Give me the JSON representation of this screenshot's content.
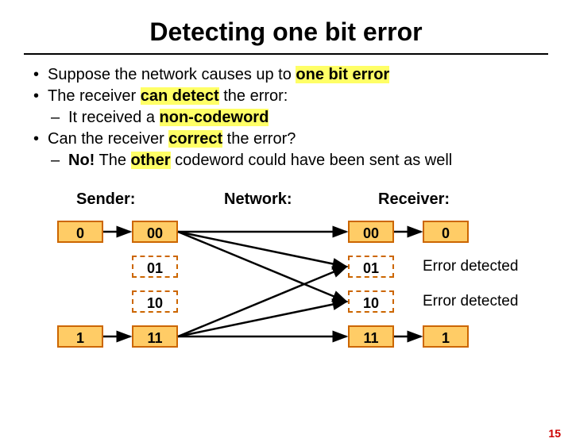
{
  "title": "Detecting one bit error",
  "bul": {
    "l1a": "Suppose the network causes up to ",
    "l1hl": "one bit error",
    "l2a": "The receiver ",
    "l2hl": "can detect",
    "l2b": " the error:",
    "l3a": "It received a ",
    "l3hl": "non-codeword",
    "l4a": "Can the receiver ",
    "l4hl": "correct",
    "l4b": " the error?",
    "l5a": "No!",
    "l5b": "  The ",
    "l5hl": "other",
    "l5c": " codeword could have been sent as well"
  },
  "cols": {
    "sender": "Sender:",
    "network": "Network:",
    "receiver": "Receiver:"
  },
  "send": {
    "b0": "0",
    "b1": "1"
  },
  "code": {
    "c00": "00",
    "c01": "01",
    "c10": "10",
    "c11": "11"
  },
  "recv": {
    "r00": "00",
    "r01": "01",
    "r10": "10",
    "r11": "11"
  },
  "out": {
    "o0": "0",
    "o1": "1",
    "err": "Error detected"
  },
  "page": "15"
}
